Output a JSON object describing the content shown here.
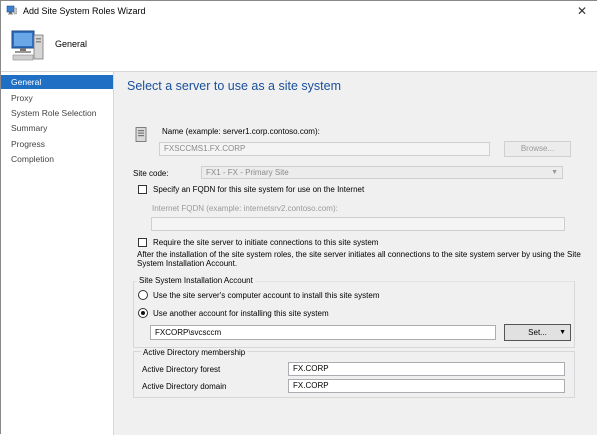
{
  "window": {
    "title": "Add Site System Roles Wizard",
    "close_glyph": "✕"
  },
  "header": {
    "title": "General",
    "icon": "computer-icon"
  },
  "sidebar": {
    "items": [
      {
        "label": "General",
        "active": true
      },
      {
        "label": "Proxy",
        "active": false
      },
      {
        "label": "System Role Selection",
        "active": false
      },
      {
        "label": "Summary",
        "active": false
      },
      {
        "label": "Progress",
        "active": false
      },
      {
        "label": "Completion",
        "active": false
      }
    ]
  },
  "main": {
    "heading": "Select a server to use as a site system",
    "name_label": "Name (example: server1.corp.contoso.com):",
    "name_value": "FXSCCMS1.FX.CORP",
    "browse_label": "Browse...",
    "site_code_label": "Site code:",
    "site_code_value": "FX1 - FX - Primary Site",
    "fqdn_checkbox_label": "Specify an FQDN for this site system for use on the Internet",
    "internet_fqdn_label": "Internet FQDN (example: internetsrv2.contoso.com):",
    "internet_fqdn_value": "",
    "initiate_checkbox_label": "Require the site server to initiate connections to this site system",
    "initiate_note": "After the  installation of the site system roles, the site server initiates all connections to the site system server by using the Site System Installation Account.",
    "install_account_group": "Site System Installation Account",
    "radio_computer_account": "Use the site server's computer account to install this site system",
    "radio_other_account": "Use another account for installing this site system",
    "account_value": "FXCORP\\svcsccm",
    "set_label": "Set...",
    "ad_group": "Active Directory membership",
    "ad_forest_label": "Active Directory forest",
    "ad_forest_value": "FX.CORP",
    "ad_domain_label": "Active Directory domain",
    "ad_domain_value": "FX.CORP"
  },
  "colors": {
    "accent": "#1f6fc5",
    "heading": "#1a4f9a",
    "panel": "#f0f0f0"
  }
}
